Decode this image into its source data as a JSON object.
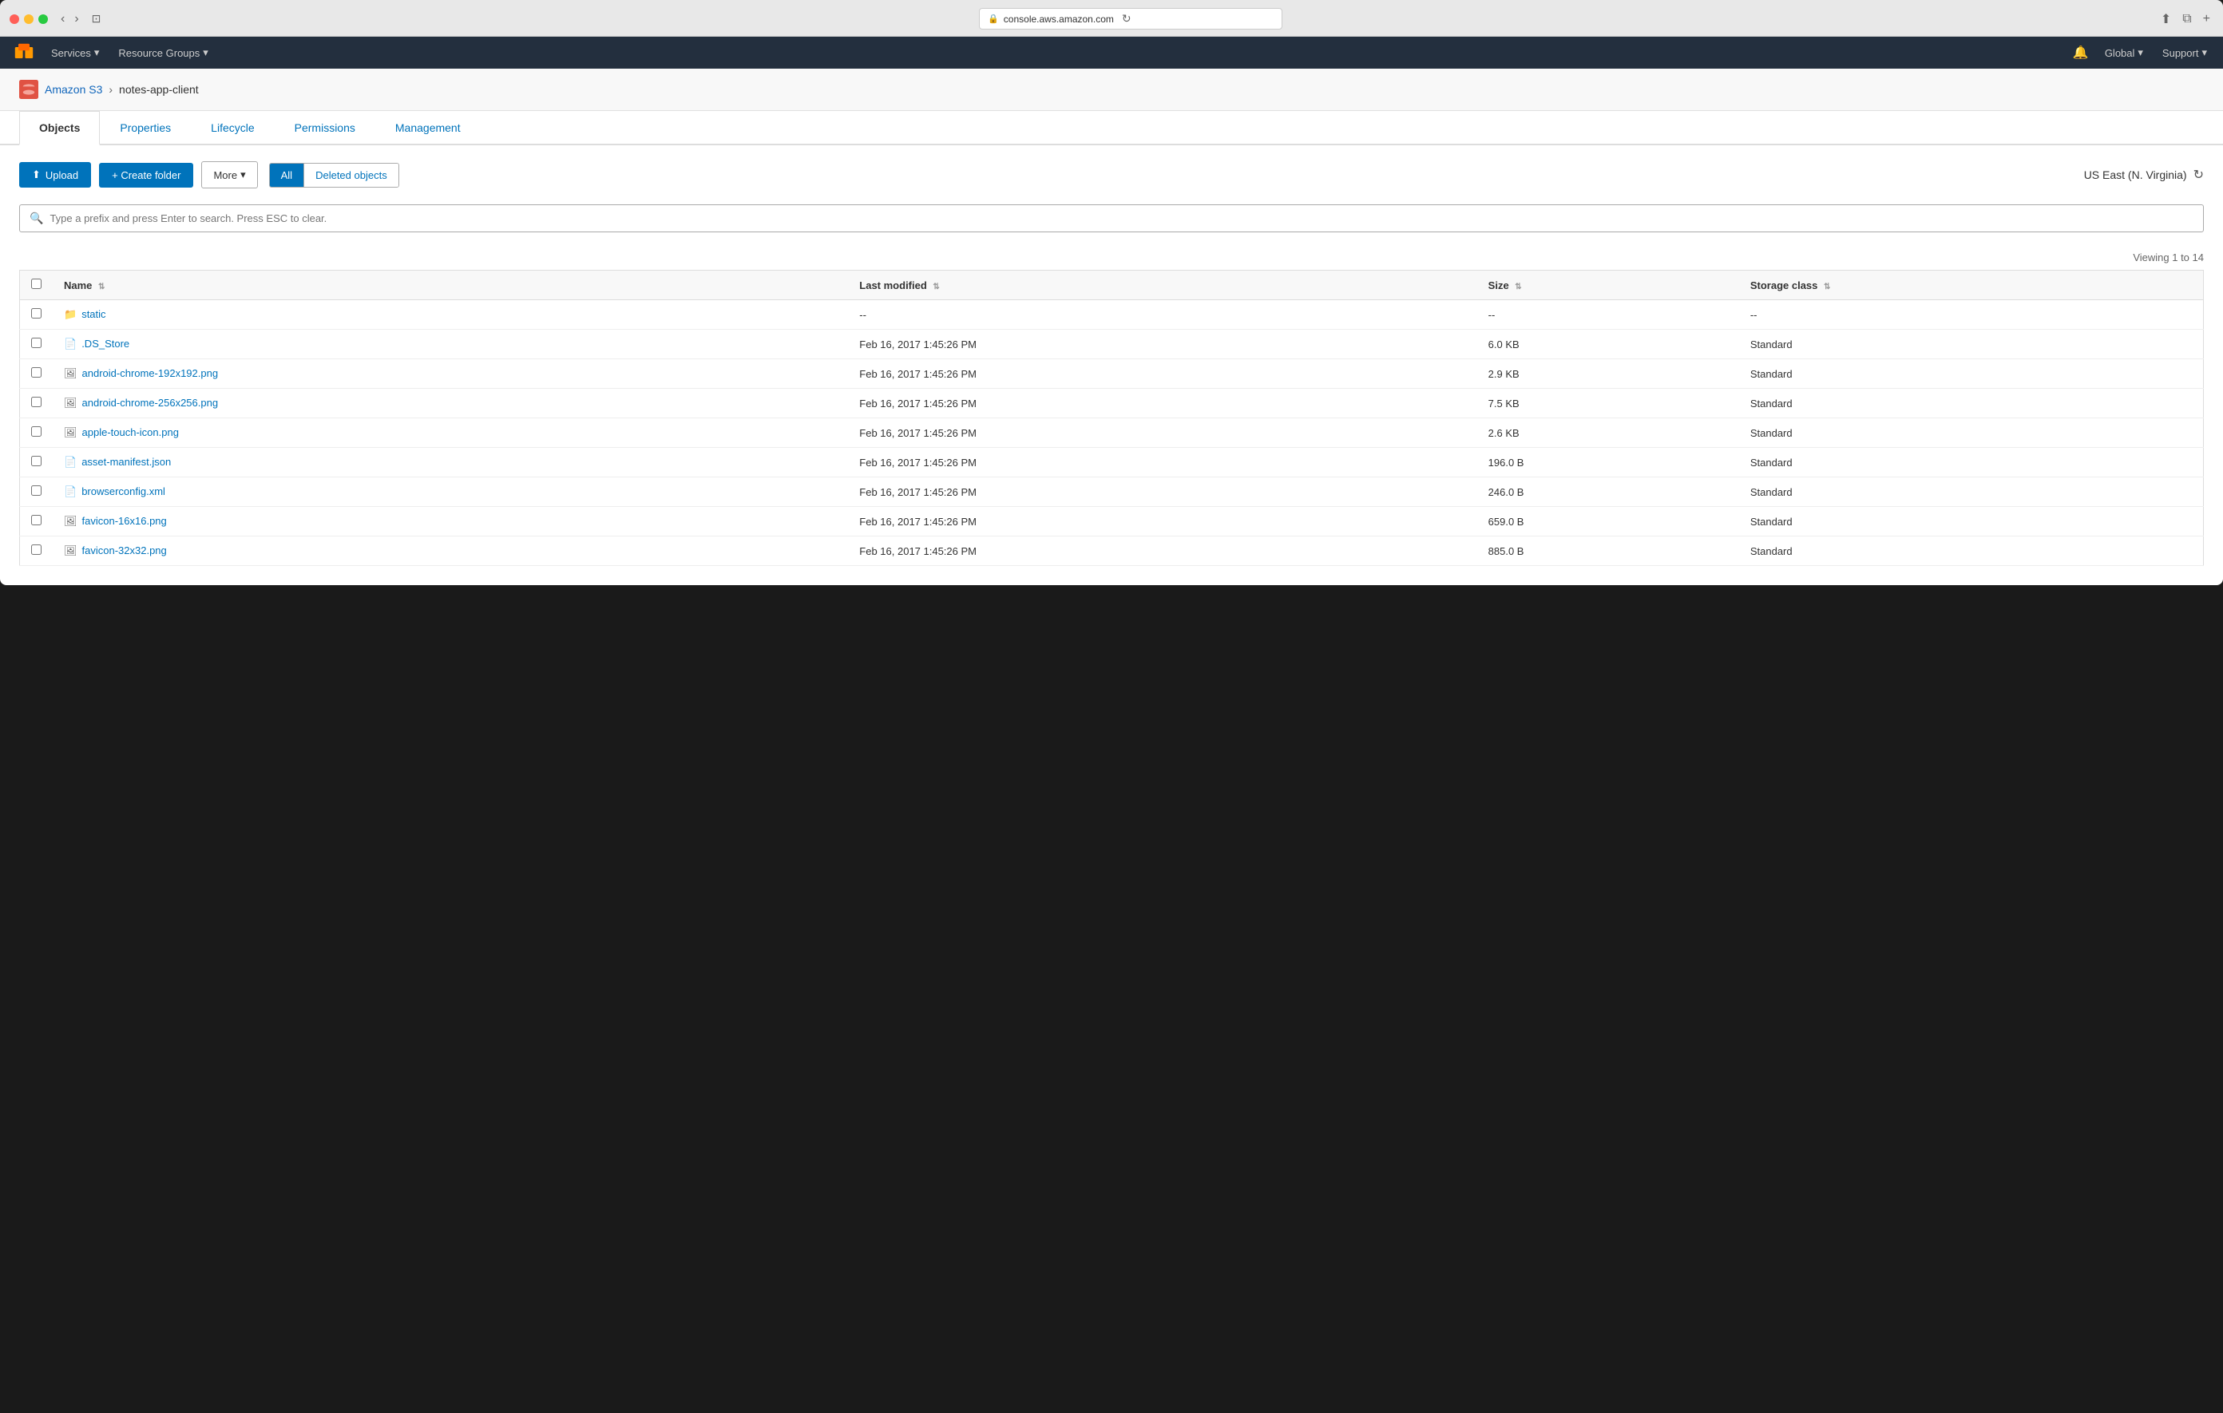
{
  "browser": {
    "url": "console.aws.amazon.com",
    "reload_label": "↻"
  },
  "navbar": {
    "services_label": "Services",
    "resource_groups_label": "Resource Groups",
    "global_label": "Global",
    "support_label": "Support"
  },
  "breadcrumb": {
    "s3_link": "Amazon S3",
    "bucket_name": "notes-app-client"
  },
  "tabs": [
    {
      "id": "objects",
      "label": "Objects",
      "active": true
    },
    {
      "id": "properties",
      "label": "Properties",
      "active": false
    },
    {
      "id": "lifecycle",
      "label": "Lifecycle",
      "active": false
    },
    {
      "id": "permissions",
      "label": "Permissions",
      "active": false
    },
    {
      "id": "management",
      "label": "Management",
      "active": false
    }
  ],
  "actions": {
    "upload_label": "Upload",
    "create_folder_label": "+ Create folder",
    "more_label": "More",
    "filter_all_label": "All",
    "filter_deleted_label": "Deleted objects",
    "region_label": "US East (N. Virginia)"
  },
  "search": {
    "placeholder": "Type a prefix and press Enter to search. Press ESC to clear."
  },
  "table": {
    "viewing_info": "Viewing 1 to 14",
    "columns": {
      "name": "Name",
      "last_modified": "Last modified",
      "size": "Size",
      "storage_class": "Storage class"
    },
    "rows": [
      {
        "name": "static",
        "type": "folder",
        "last_modified": "--",
        "size": "--",
        "storage_class": "--"
      },
      {
        "name": ".DS_Store",
        "type": "file",
        "last_modified": "Feb 16, 2017 1:45:26 PM",
        "size": "6.0 KB",
        "storage_class": "Standard"
      },
      {
        "name": "android-chrome-192x192.png",
        "type": "image",
        "last_modified": "Feb 16, 2017 1:45:26 PM",
        "size": "2.9 KB",
        "storage_class": "Standard"
      },
      {
        "name": "android-chrome-256x256.png",
        "type": "image",
        "last_modified": "Feb 16, 2017 1:45:26 PM",
        "size": "7.5 KB",
        "storage_class": "Standard"
      },
      {
        "name": "apple-touch-icon.png",
        "type": "image",
        "last_modified": "Feb 16, 2017 1:45:26 PM",
        "size": "2.6 KB",
        "storage_class": "Standard"
      },
      {
        "name": "asset-manifest.json",
        "type": "file",
        "last_modified": "Feb 16, 2017 1:45:26 PM",
        "size": "196.0 B",
        "storage_class": "Standard"
      },
      {
        "name": "browserconfig.xml",
        "type": "file",
        "last_modified": "Feb 16, 2017 1:45:26 PM",
        "size": "246.0 B",
        "storage_class": "Standard"
      },
      {
        "name": "favicon-16x16.png",
        "type": "image",
        "last_modified": "Feb 16, 2017 1:45:26 PM",
        "size": "659.0 B",
        "storage_class": "Standard"
      },
      {
        "name": "favicon-32x32.png",
        "type": "image",
        "last_modified": "Feb 16, 2017 1:45:26 PM",
        "size": "885.0 B",
        "storage_class": "Standard"
      }
    ]
  }
}
